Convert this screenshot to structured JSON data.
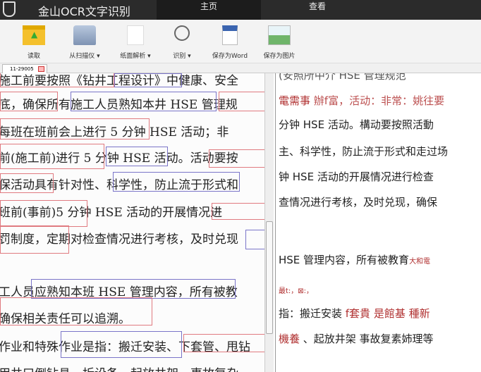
{
  "app": {
    "title": "金山OCR文字识别",
    "tabs": [
      "主页",
      "查看"
    ]
  },
  "toolbar": [
    {
      "label": "读取",
      "icon": "folder-icon"
    },
    {
      "label": "从扫描仪 ▾",
      "icon": "scanner-icon"
    },
    {
      "label": "纸面解析 ▾",
      "icon": "page-analysis-icon"
    },
    {
      "label": "识别 ▾",
      "icon": "search-icon"
    },
    {
      "label": "保存为Word",
      "icon": "word-document-icon"
    },
    {
      "label": "保存为图片",
      "icon": "image-icon"
    }
  ],
  "doc_tab": "11-29005",
  "left_lines": [
    "施工前要按照《钻井工程设计》中健康、安全",
    "底，确保所有施工人员熟知本井 HSE 管理规",
    "每班在班前会上进行 5 分钟 HSE 活动；非",
    "前(施工前)进行 5 分钟 HSE 活动。活动要按",
    "保活动具有针对性、科学性，防止流于形式和",
    "班前(事前)5 分钟 HSE 活动的开展情况进",
    "罚制度，定期对检查情况进行考核，及时兑现",
    "工人员应熟知本班 HSE 管理内容，所有被教",
    "确保相关责任可以追溯。",
    "作业和特殊作业是指：搬迁安装、下套管、甩钻",
    "用井口倒钻具、拆设备、起放井架、事故复杂"
  ],
  "right_lines": [
    "(安照所中介 HSE 管理规范",
    {
      "red": "電需事",
      "rest": "  辦f富，活动：非常：姚往要"
    },
    "分钟 HSE 活动。構动要按照活動",
    "主、科学性，防止流于形式和走过场",
    "钟 HSE 活动的开展情况进行检查",
    "查情况进行考核，及时兑现，确保",
    {
      "text": "HSE 管理内容，所有被教育",
      "red": "大和電"
    },
    {
      "red": "最t:，⊠:，"
    },
    {
      "text": "指：搬迁安装 ",
      "red": "f套貴  是館基  種新"
    },
    {
      "red": "機養",
      "text": " 、起放井架  事故复素姉理等"
    }
  ]
}
